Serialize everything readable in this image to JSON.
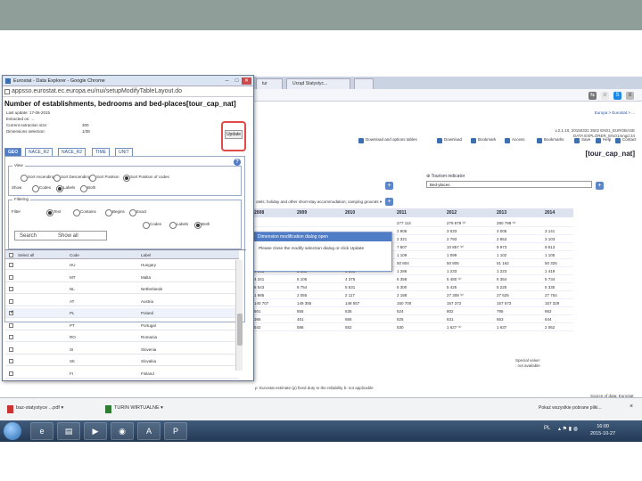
{
  "browser": {
    "bg_tabs": [
      "tur",
      "Urząd Statystyc...",
      ""
    ],
    "bg_right_info": [
      "Europa > Eurostat > ...",
      "v.2.1.10, 20150331 3502 EN01_EUROBASE",
      "DATA EXPLORER_ENO1mngd 34"
    ],
    "bg_toolbar": [
      "Download and options tables",
      "Download",
      "Bookmark",
      "Access",
      "Bookmarks",
      "Save",
      "Help",
      "Contact"
    ],
    "bg_title": "[tour_cap_nat]",
    "bg_indicator_label": "Tourism indicator",
    "bg_indicator_value": "Bed-places",
    "bg_accommodation": "otels; holiday and other short-stay accommodation; camping grounds",
    "bg_years": [
      "2008",
      "2009",
      "2010",
      "2011",
      "2012",
      "2013",
      "2014"
    ],
    "bg_rows": [
      [
        "",
        "",
        "",
        "277 112",
        "279 879 ⁽ᵖ⁾",
        "280 799 ⁽ᵖ⁾",
        ""
      ],
      [
        "",
        "",
        "",
        "2 906",
        "3 033",
        "3 005",
        "3 141"
      ],
      [
        "",
        "",
        "",
        "2 321",
        "2 793",
        "2 853",
        "3 103"
      ],
      [
        "",
        "",
        "",
        "7 807",
        "10 857 ⁽ᵖ⁾",
        "9 973",
        "9 613"
      ],
      [
        "",
        "",
        "",
        "1 109",
        "1 099",
        "1 102",
        "1 105"
      ],
      [
        "",
        "",
        "",
        "50 804",
        "50 805",
        "51 162",
        "50 325"
      ],
      [
        "5 343",
        "5 535",
        "1 341",
        "1 286",
        "1 233",
        "1 223",
        "1 419"
      ],
      [
        "4 341",
        "5 105",
        "4 375",
        "5 358",
        "5 480 ⁽ᵖ⁾",
        "5 354",
        "5 734"
      ],
      [
        "6 543",
        "8 754",
        "5 531",
        "5 300",
        "5 425",
        "5 225",
        "5 335"
      ],
      [
        "1 985",
        "2 055",
        "2 117",
        "2 188",
        "27 308 ⁽ᵖ⁾",
        "27 625",
        "27 754"
      ],
      [
        "140 707",
        "149 355",
        "148 557",
        "150 700",
        "157 372",
        "157 573",
        "157 329"
      ],
      [
        "501",
        "555",
        "535",
        "524",
        "802",
        "795",
        "862"
      ],
      [
        "366",
        "451",
        "566",
        "525",
        "631",
        "653",
        "644"
      ],
      [
        "542",
        "586",
        "552",
        "530",
        "1 627 ⁽ᵖ⁾",
        "1 637",
        "2 062"
      ]
    ],
    "bg_modal_title": "Dimension modification dialog open",
    "bg_modal_body": "Please close the modify selection dialog or click Update",
    "bg_footnotes": [
      "Special value:",
      ": not available"
    ],
    "bg_flags": "p: Eurostat estimate (p) fixed duty to the reliability b: not applicable",
    "bg_source": "Source of data: Eurostat"
  },
  "popup": {
    "window_title": "Eurostat - Data Explorer - Google Chrome",
    "url": "appsso.eurostat.ec.europa.eu/nui/setupModifyTableLayout.do",
    "heading": "Number of establishments, bedrooms and bed-places[tour_cap_nat]",
    "meta": [
      {
        "label": "Last update: 17-06-2015",
        "value": ""
      },
      {
        "label": "Extracted on: ...",
        "value": ""
      },
      {
        "label": "Current extraction size:",
        "value": "300"
      },
      {
        "label": "Dimensions selection:",
        "value": "1/38"
      }
    ],
    "update_label": "Update",
    "tabs": [
      "GEO",
      "NACE_R2",
      "NACE_R2",
      "TIME",
      "UNIT"
    ],
    "view": {
      "legend": "View",
      "order_label": "",
      "order_options": [
        "Sort Ascending",
        "Sort Descending",
        "Sort Position",
        "Sort Position of codes"
      ],
      "show_label": "Show",
      "show_options": [
        "Codes",
        "Labels",
        "Both"
      ]
    },
    "filtering": {
      "legend": "Filtering",
      "filter_label": "Filter",
      "filter_options": [
        "Text",
        "Contains",
        "Begins",
        "Exact"
      ],
      "scope_options": [
        "Codes",
        "Labels",
        "Both"
      ],
      "search_label": "Search",
      "show_all_label": "Show all"
    },
    "grid": {
      "headers": [
        "Select all",
        "Code",
        "Label"
      ],
      "rows": [
        {
          "checked": false,
          "code": "HU",
          "label": "Hungary"
        },
        {
          "checked": false,
          "code": "MT",
          "label": "Malta"
        },
        {
          "checked": false,
          "code": "NL",
          "label": "Netherlands"
        },
        {
          "checked": false,
          "code": "AT",
          "label": "Austria"
        },
        {
          "checked": true,
          "code": "PL",
          "label": "Poland"
        },
        {
          "checked": false,
          "code": "PT",
          "label": "Portugal"
        },
        {
          "checked": false,
          "code": "RO",
          "label": "Romania"
        },
        {
          "checked": false,
          "code": "SI",
          "label": "Slovenia"
        },
        {
          "checked": false,
          "code": "SK",
          "label": "Slovakia"
        },
        {
          "checked": false,
          "code": "FI",
          "label": "Finland"
        }
      ]
    }
  },
  "downloads": {
    "items": [
      "baz-statystyce ...pdf",
      "TURIN WIRTUALNE"
    ],
    "right_text": "Pokaż wszystkie pobrane pliki...",
    "close": "×"
  },
  "taskbar": {
    "lang": "PL",
    "time": "16:00",
    "date": "2015-10-27"
  },
  "colors": {
    "accent": "#4f7cc4",
    "highlight": "#e04a4a",
    "band": "#8f9e98"
  }
}
